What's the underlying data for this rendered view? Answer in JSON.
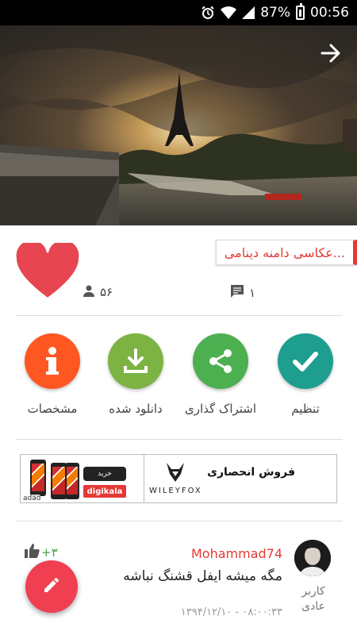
{
  "status_bar": {
    "battery": "87%",
    "time": "00:56",
    "icons": [
      "alarm-icon",
      "wifi-icon",
      "signal-icon",
      "battery-icon"
    ]
  },
  "photo": {
    "title": "عکاسی دامنه دینامی...",
    "likes_icon": "heart-icon",
    "users_count": "۵۶",
    "comments_count": "۱"
  },
  "actions": [
    {
      "label": "تنظیم",
      "icon": "check-icon",
      "color": "#1e9e8f"
    },
    {
      "label": "اشتراک گذاری",
      "icon": "share-icon",
      "color": "#4caf50"
    },
    {
      "label": "دانلود شده",
      "icon": "download-icon",
      "color": "#7cb342"
    },
    {
      "label": "مشخصات",
      "icon": "info-icon",
      "color": "#ff5722"
    }
  ],
  "ad": {
    "headline": "فروش انحصاری",
    "brand": "WILEYFOX",
    "buy_label": "خرید",
    "store": "digikala",
    "tag": "adad"
  },
  "comment": {
    "username": "Mohammad74",
    "text": "مگه میشه ایفل قشنگ نباشه",
    "role": "کاربر عادی",
    "timestamp": "۱۳۹۴/۱۲/۱۰ - ۰۸:۰۰:۳۳",
    "likes": "+۳"
  },
  "fab": {
    "icon": "edit-icon"
  },
  "colors": {
    "accent": "#e53935",
    "fab": "#ef3f50"
  }
}
